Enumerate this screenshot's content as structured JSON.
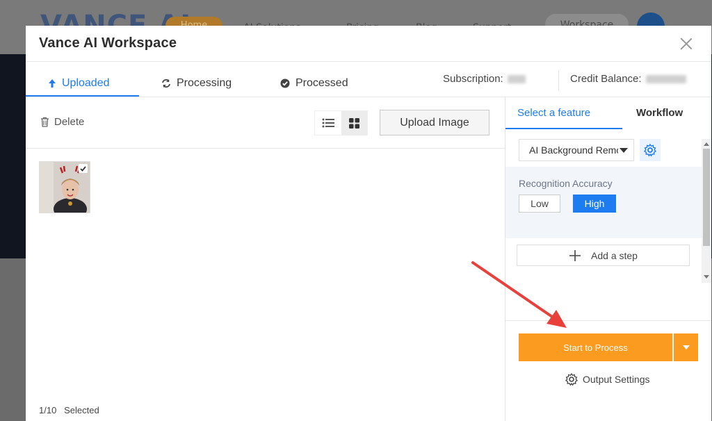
{
  "background": {
    "logo": "VANCE AI",
    "home_label": "Home",
    "nav": [
      "AI Solutions",
      "Pricing",
      "Blog",
      "Support"
    ],
    "workspace_label": "Workspace"
  },
  "modal": {
    "title": "Vance AI Workspace",
    "tabs": [
      {
        "label": "Uploaded",
        "icon": "upload-arrow-icon",
        "active": true
      },
      {
        "label": "Processing",
        "icon": "refresh-icon",
        "active": false
      },
      {
        "label": "Processed",
        "icon": "check-circle-icon",
        "active": false
      }
    ],
    "subscription_label": "Subscription:",
    "credit_label": "Credit Balance:",
    "accent_color": "#1c7cf0"
  },
  "toolbar": {
    "delete_label": "Delete",
    "upload_label": "Upload Image",
    "view_modes": [
      "list-view-icon",
      "grid-view-icon"
    ],
    "active_view": "grid-view-icon"
  },
  "images": [
    {
      "selected": true
    }
  ],
  "footer": {
    "selected_text": "1/10   Selected"
  },
  "panel": {
    "tabs": [
      {
        "label": "Select a feature",
        "active": true
      },
      {
        "label": "Workflow",
        "active": false
      }
    ],
    "feature_value": "AI Background Remover",
    "accuracy_label": "Recognition Accuracy",
    "accuracy_options": [
      "Low",
      "High"
    ],
    "accuracy_selected": "High",
    "add_step_label": "Add a step",
    "process_label": "Start to Process",
    "process_color": "#fb9b1f",
    "output_settings_label": "Output Settings"
  }
}
